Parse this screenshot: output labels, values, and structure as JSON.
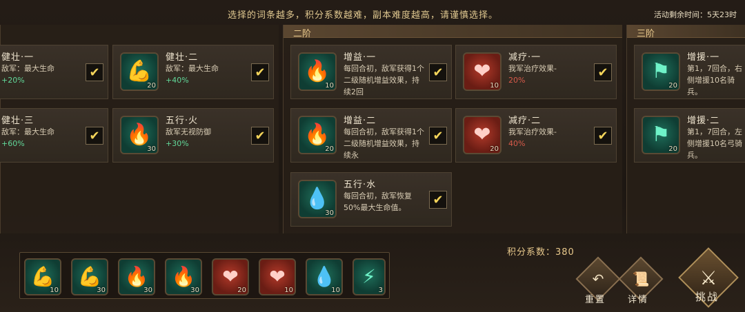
{
  "header": {
    "notice": "选择的词条越多，积分系数越难，副本难度越高，请谨慎选择。",
    "timer": "活动剩余时间：5天23时"
  },
  "tiers": [
    {
      "label": ""
    },
    {
      "label": "二阶"
    },
    {
      "label": "三阶"
    }
  ],
  "cards": {
    "c1": {
      "title": "健壮·一",
      "desc": "敌军：最大生命",
      "value": "+20%",
      "level": "",
      "icon": "muscle-icon"
    },
    "c2": {
      "title": "健壮·二",
      "desc": "敌军：最大生命",
      "value": "+40%",
      "level": "20",
      "icon": "muscle-icon"
    },
    "c3": {
      "title": "健壮·三",
      "desc": "敌军：最大生命",
      "value": "+60%",
      "level": "",
      "icon": "muscle-icon"
    },
    "c4": {
      "title": "五行·火",
      "desc": "敌军无视防御",
      "value": "+30%",
      "level": "30",
      "icon": "fan-fire-icon"
    },
    "c5": {
      "title": "增益·一",
      "desc": "每回合初，敌军获得1个二级随机增益效果，持续2回",
      "value": "",
      "level": "10",
      "icon": "flame-figure-icon"
    },
    "c6": {
      "title": "减疗·一",
      "desc": "我军治疗效果-",
      "value": "20%",
      "level": "10",
      "icon": "heart-icon"
    },
    "c7": {
      "title": "增益·二",
      "desc": "每回合初，敌军获得1个二级随机增益效果，持续永",
      "value": "",
      "level": "20",
      "icon": "flame-figure-icon"
    },
    "c8": {
      "title": "减疗·二",
      "desc": "我军治疗效果-",
      "value": "40%",
      "level": "20",
      "icon": "heart-icon"
    },
    "c9": {
      "title": "五行·水",
      "desc": "每回合初，敌军恢复50%最大生命值。",
      "value": "",
      "level": "30",
      "icon": "fan-water-icon"
    },
    "c10": {
      "title": "增援·一",
      "desc": "第1，7回合，右侧增援10名骑兵。",
      "value": "",
      "level": "20",
      "icon": "banner-troops-icon"
    },
    "c11": {
      "title": "增援·二",
      "desc": "第1，7回合，左侧增援10名弓骑兵。",
      "value": "",
      "level": "20",
      "icon": "banner-troops-icon"
    }
  },
  "tray": [
    {
      "icon": "muscle-icon",
      "level": "10"
    },
    {
      "icon": "muscle-icon",
      "level": "30"
    },
    {
      "icon": "fan-fire-icon",
      "level": "30"
    },
    {
      "icon": "fan-fire-icon",
      "level": "30"
    },
    {
      "icon": "heart-icon",
      "level": "20"
    },
    {
      "icon": "heart-icon",
      "level": "10"
    },
    {
      "icon": "fan-water-icon",
      "level": "10"
    },
    {
      "icon": "fan-lightning-icon",
      "level": "3"
    }
  ],
  "score": "积分系数：380",
  "buttons": {
    "reset": "重置",
    "details": "详情",
    "challenge": "挑战"
  },
  "colors": {
    "accent": "#e8c98c",
    "positive": "#62d99a",
    "negative": "#d95a4a",
    "check": "#f3d45a"
  }
}
